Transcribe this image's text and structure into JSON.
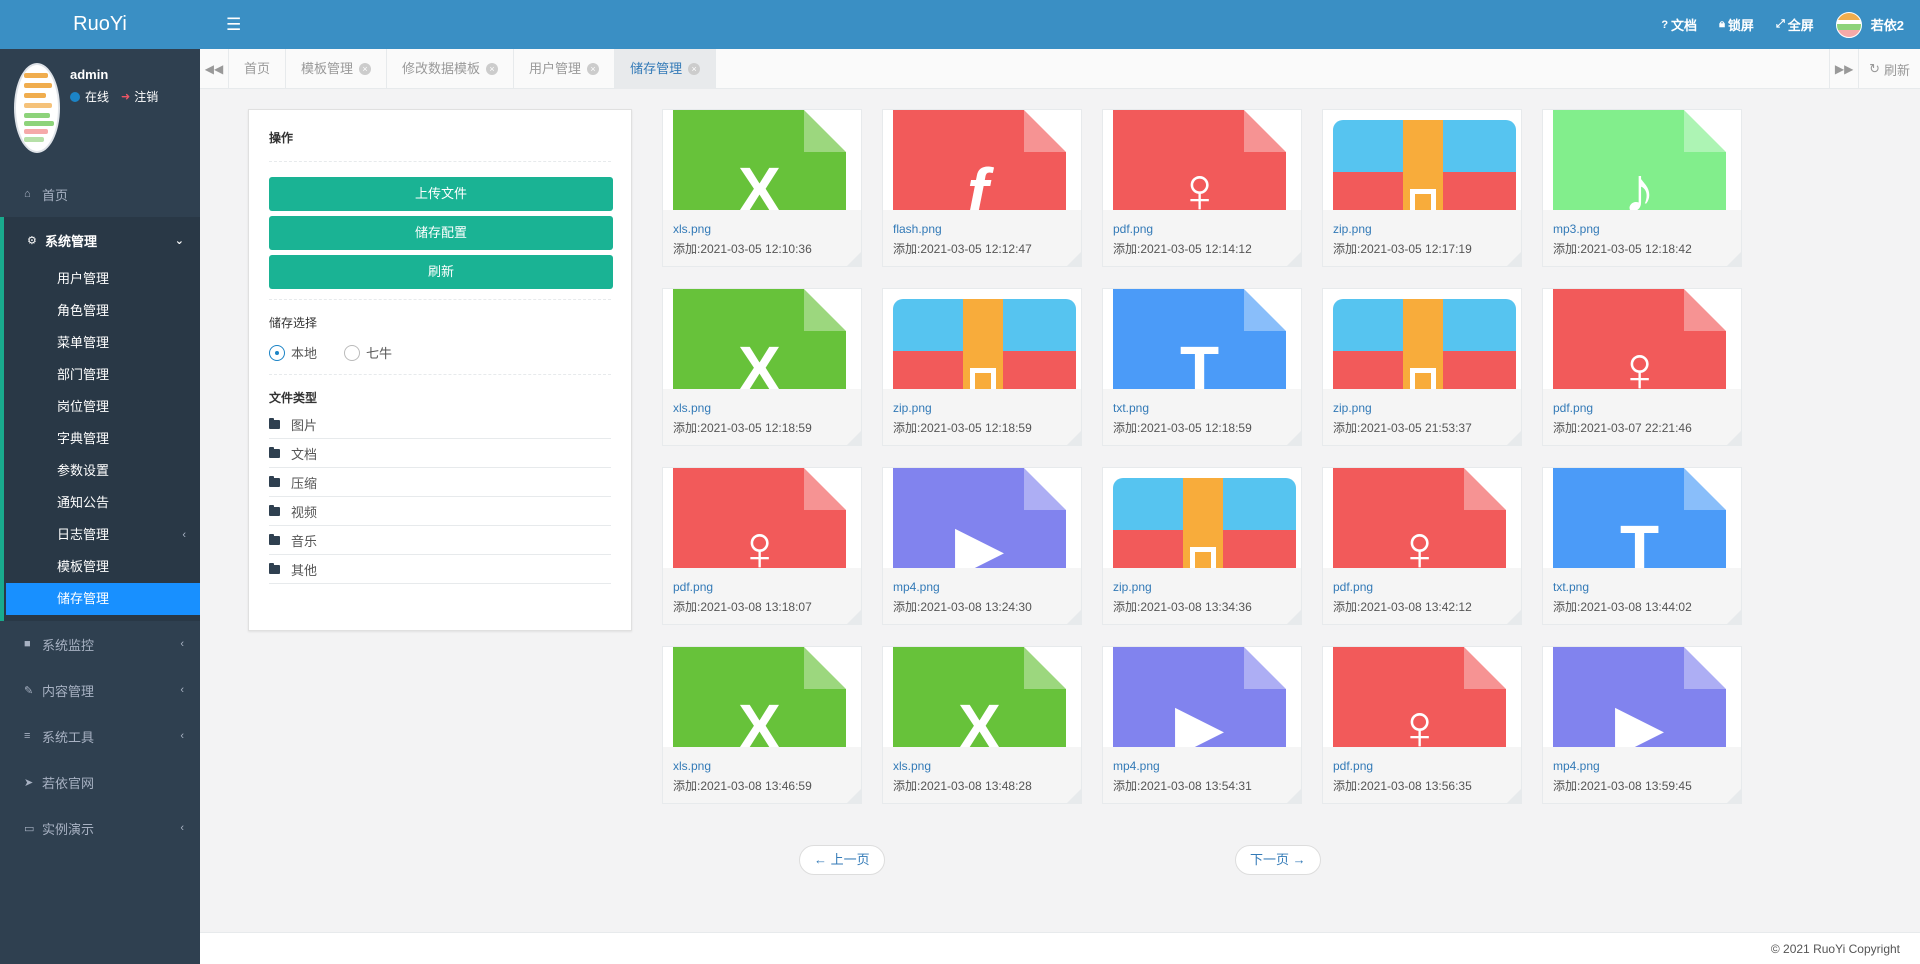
{
  "app": {
    "logo": "RuoYi"
  },
  "user": {
    "name": "admin",
    "status": "在线",
    "logout": "注销"
  },
  "sidebar": {
    "home": "首页",
    "group": {
      "label": "系统管理",
      "items": [
        "用户管理",
        "角色管理",
        "菜单管理",
        "部门管理",
        "岗位管理",
        "字典管理",
        "参数设置",
        "通知公告",
        "日志管理",
        "模板管理",
        "储存管理"
      ],
      "active_index": 10
    },
    "others": [
      "系统监控",
      "内容管理",
      "系统工具",
      "若依官网",
      "实例演示"
    ]
  },
  "topbar": {
    "docs": "文档",
    "lock": "锁屏",
    "fullscreen": "全屏",
    "username": "若依2"
  },
  "tabs": {
    "items": [
      "首页",
      "模板管理",
      "修改数据模板",
      "用户管理",
      "储存管理"
    ],
    "active": "储存管理",
    "refresh": "刷新"
  },
  "panel": {
    "ops_title": "操作",
    "buttons": {
      "upload": "上传文件",
      "config": "储存配置",
      "refresh": "刷新"
    },
    "storage_title": "储存选择",
    "storage_options": [
      "本地",
      "七牛"
    ],
    "storage_selected": "本地",
    "filetype_title": "文件类型",
    "filetypes": [
      "图片",
      "文档",
      "压缩",
      "视频",
      "音乐",
      "其他"
    ]
  },
  "files": [
    {
      "name": "xls.png",
      "date": "添加:2021-03-05 12:10:36",
      "kind": "xls"
    },
    {
      "name": "flash.png",
      "date": "添加:2021-03-05 12:12:47",
      "kind": "flash"
    },
    {
      "name": "pdf.png",
      "date": "添加:2021-03-05 12:14:12",
      "kind": "pdf"
    },
    {
      "name": "zip.png",
      "date": "添加:2021-03-05 12:17:19",
      "kind": "zip"
    },
    {
      "name": "mp3.png",
      "date": "添加:2021-03-05 12:18:42",
      "kind": "mp3"
    },
    {
      "name": "xls.png",
      "date": "添加:2021-03-05 12:18:59",
      "kind": "xls"
    },
    {
      "name": "zip.png",
      "date": "添加:2021-03-05 12:18:59",
      "kind": "zip"
    },
    {
      "name": "txt.png",
      "date": "添加:2021-03-05 12:18:59",
      "kind": "txt"
    },
    {
      "name": "zip.png",
      "date": "添加:2021-03-05 21:53:37",
      "kind": "zip"
    },
    {
      "name": "pdf.png",
      "date": "添加:2021-03-07 22:21:46",
      "kind": "pdf"
    },
    {
      "name": "pdf.png",
      "date": "添加:2021-03-08 13:18:07",
      "kind": "pdf"
    },
    {
      "name": "mp4.png",
      "date": "添加:2021-03-08 13:24:30",
      "kind": "mp4"
    },
    {
      "name": "zip.png",
      "date": "添加:2021-03-08 13:34:36",
      "kind": "zip"
    },
    {
      "name": "pdf.png",
      "date": "添加:2021-03-08 13:42:12",
      "kind": "pdf"
    },
    {
      "name": "txt.png",
      "date": "添加:2021-03-08 13:44:02",
      "kind": "txt"
    },
    {
      "name": "xls.png",
      "date": "添加:2021-03-08 13:46:59",
      "kind": "xls"
    },
    {
      "name": "xls.png",
      "date": "添加:2021-03-08 13:48:28",
      "kind": "xls"
    },
    {
      "name": "mp4.png",
      "date": "添加:2021-03-08 13:54:31",
      "kind": "mp4"
    },
    {
      "name": "pdf.png",
      "date": "添加:2021-03-08 13:56:35",
      "kind": "pdf"
    },
    {
      "name": "mp4.png",
      "date": "添加:2021-03-08 13:59:45",
      "kind": "mp4"
    }
  ],
  "file_colors": {
    "xls": "#67c23a",
    "flash": "#f25a5a",
    "pdf": "#f25a5a",
    "mp3": "#82ee8c",
    "txt": "#4b9bf8",
    "mp4": "#8183ee"
  },
  "pager": {
    "prev": "← 上一页",
    "next": "下一页 →"
  },
  "footer": {
    "copyright": "© 2021 RuoYi Copyright"
  }
}
